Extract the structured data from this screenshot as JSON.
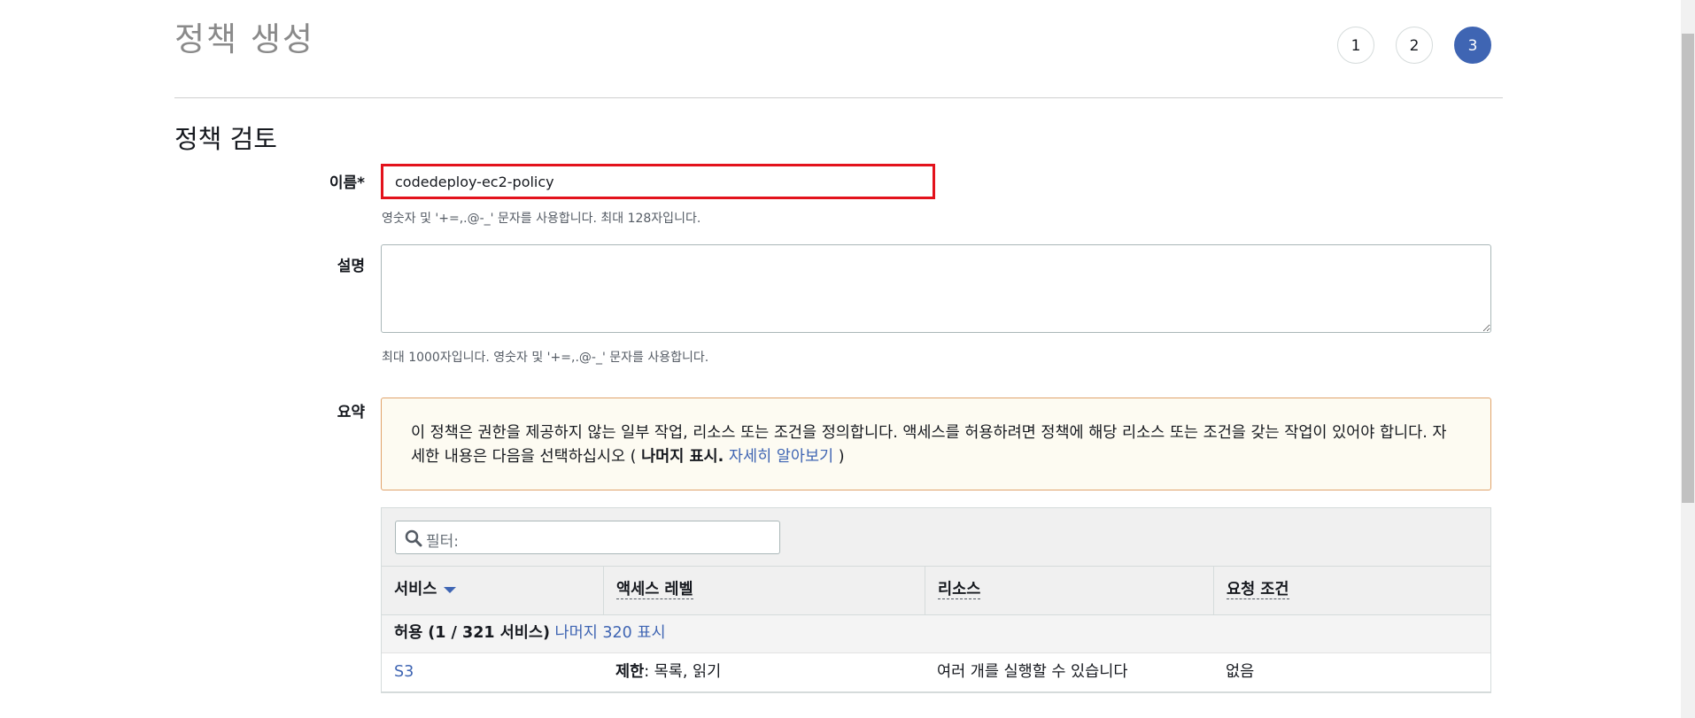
{
  "page": {
    "title": "정책 생성"
  },
  "steps": [
    "1",
    "2",
    "3"
  ],
  "section": {
    "title": "정책 검토"
  },
  "form": {
    "name_label": "이름*",
    "name_value": "codedeploy-ec2-policy",
    "name_hint": "영숫자 및 '+=,.@-_' 문자를 사용합니다. 최대 128자입니다.",
    "desc_label": "설명",
    "desc_value": "",
    "desc_hint": "최대 1000자입니다. 영숫자 및 '+=,.@-_' 문자를 사용합니다.",
    "summary_label": "요약"
  },
  "warning": {
    "text": "이 정책은 권한을 제공하지 않는 일부 작업, 리소스 또는 조건을 정의합니다. 액세스를 허용하려면 정책에 해당 리소스 또는 조건을 갖는 작업이 있어야 합니다. 자세한 내용은 다음을 선택하십시오 (",
    "bold": "나머지 표시.",
    "link": "자세히 알아보기",
    "close": ")"
  },
  "filter": {
    "placeholder": "필터:",
    "icon": "search-icon"
  },
  "table": {
    "headers": [
      "서비스",
      "액세스 레벨",
      "리소스",
      "요청 조건"
    ],
    "group": {
      "label": "허용 (1 / 321 서비스)",
      "link": "나머지 320 표시"
    },
    "rows": [
      {
        "service": "S3",
        "access_bold": "제한",
        "access_rest": ": 목록, 읽기",
        "resource": "여러 개를 실행할 수 있습니다",
        "condition": "없음"
      }
    ]
  },
  "colors": {
    "accent": "#3f65b3",
    "highlight_border": "#e3121c",
    "warning_border": "#e0a36b"
  }
}
